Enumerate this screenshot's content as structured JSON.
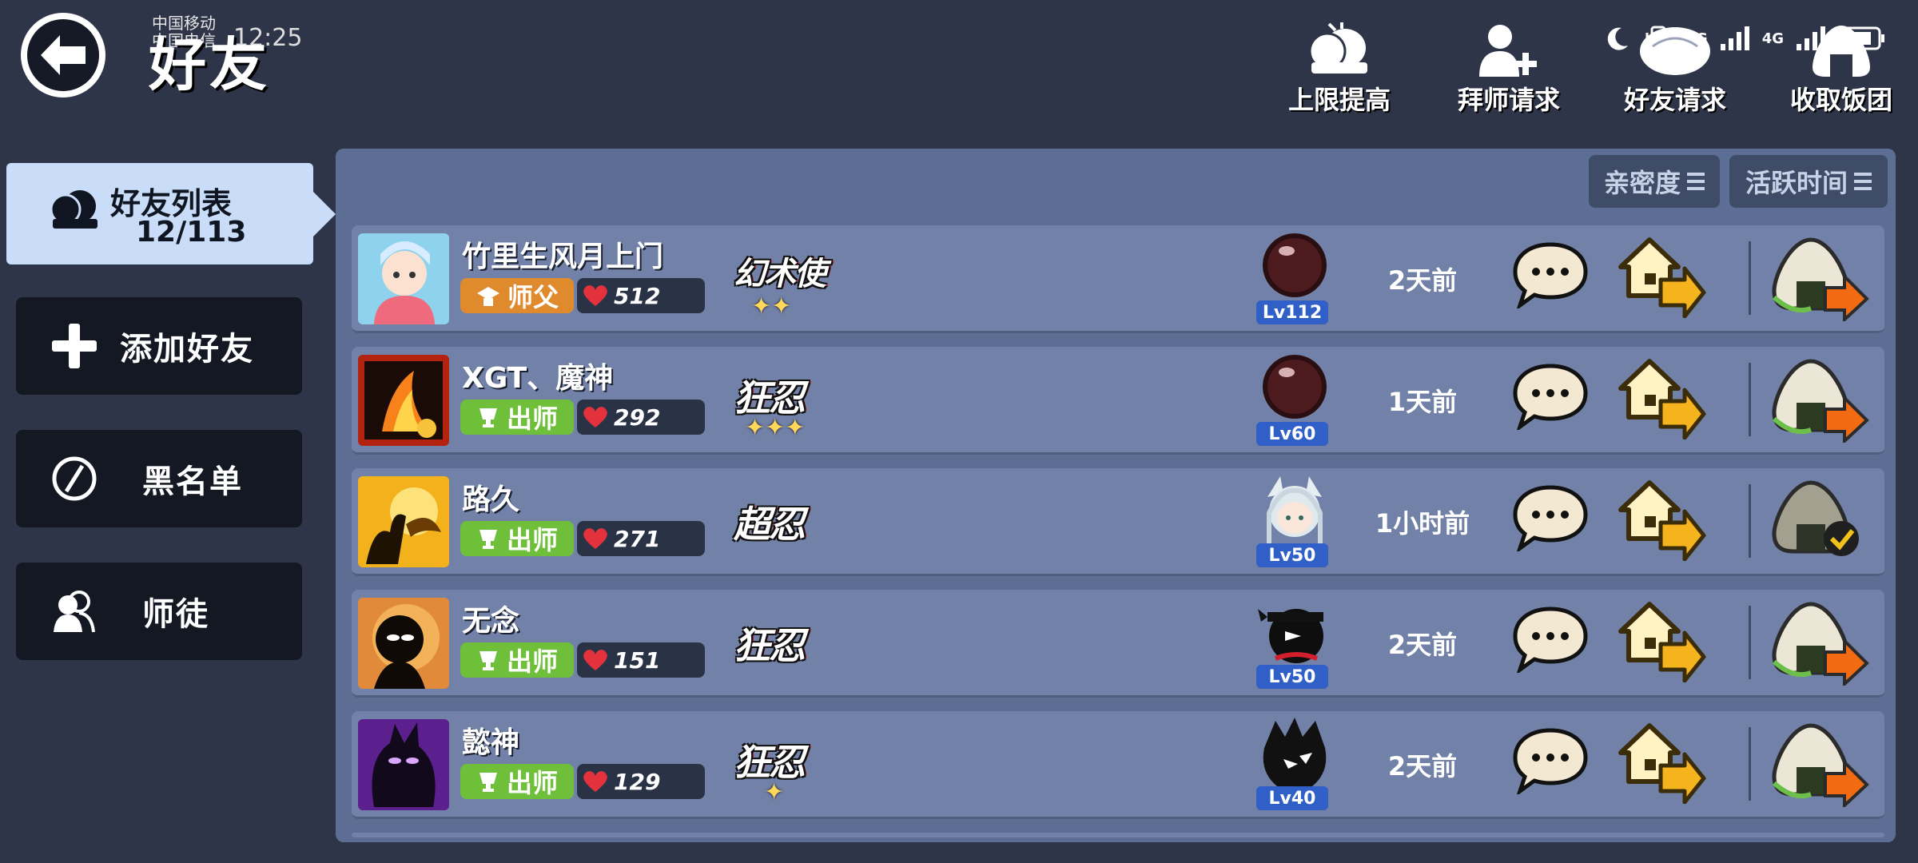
{
  "statusbar": {
    "carrier_line1": "中国移动",
    "carrier_line2": "中国电信",
    "time": "12:25",
    "network_labels": [
      "5G",
      "4G"
    ]
  },
  "header": {
    "title": "好友",
    "actions": [
      {
        "label": "上限提高",
        "icon": "raise-limit-icon"
      },
      {
        "label": "拜师请求",
        "icon": "mentor-request-icon"
      },
      {
        "label": "好友请求",
        "icon": "friend-request-icon"
      },
      {
        "label": "收取饭团",
        "icon": "rice-ball-icon"
      }
    ]
  },
  "sidebar": {
    "active_tab": {
      "label": "好友列表",
      "count": "12/113"
    },
    "buttons": [
      {
        "label": "添加好友",
        "icon": "plus-icon"
      },
      {
        "label": "黑名单",
        "icon": "block-icon"
      },
      {
        "label": "师徒",
        "icon": "mentor-icon"
      }
    ]
  },
  "sort": {
    "intimacy_label": "亲密度",
    "active_time_label": "活跃时间"
  },
  "friends": [
    {
      "name": "竹里生风月上门",
      "role": "师父",
      "intimacy": "512",
      "rank": "幻术使",
      "stars": "✦✦",
      "level": "Lv112",
      "last_active": "2天前",
      "gift_state": "send"
    },
    {
      "name": "XGT、魔神",
      "role": "出师",
      "intimacy": "292",
      "rank": "狂忍",
      "stars": "✦✦✦",
      "level": "Lv60",
      "last_active": "1天前",
      "gift_state": "send"
    },
    {
      "name": "路久",
      "role": "出师",
      "intimacy": "271",
      "rank": "超忍",
      "stars": "",
      "level": "Lv50",
      "last_active": "1小时前",
      "gift_state": "sent"
    },
    {
      "name": "无念",
      "role": "出师",
      "intimacy": "151",
      "rank": "狂忍",
      "stars": "",
      "level": "Lv50",
      "last_active": "2天前",
      "gift_state": "send"
    },
    {
      "name": "懿神",
      "role": "出师",
      "intimacy": "129",
      "rank": "狂忍",
      "stars": "✦",
      "level": "Lv40",
      "last_active": "2天前",
      "gift_state": "send"
    }
  ],
  "colors": {
    "background": "#2f3548",
    "panel": "#5c6e93",
    "row": "#7281a8",
    "active_tab": "#c9ddf8",
    "master_badge": "#e08a2e",
    "graduated_badge": "#6fbf3a",
    "level_badge": "#2f5fc7"
  }
}
